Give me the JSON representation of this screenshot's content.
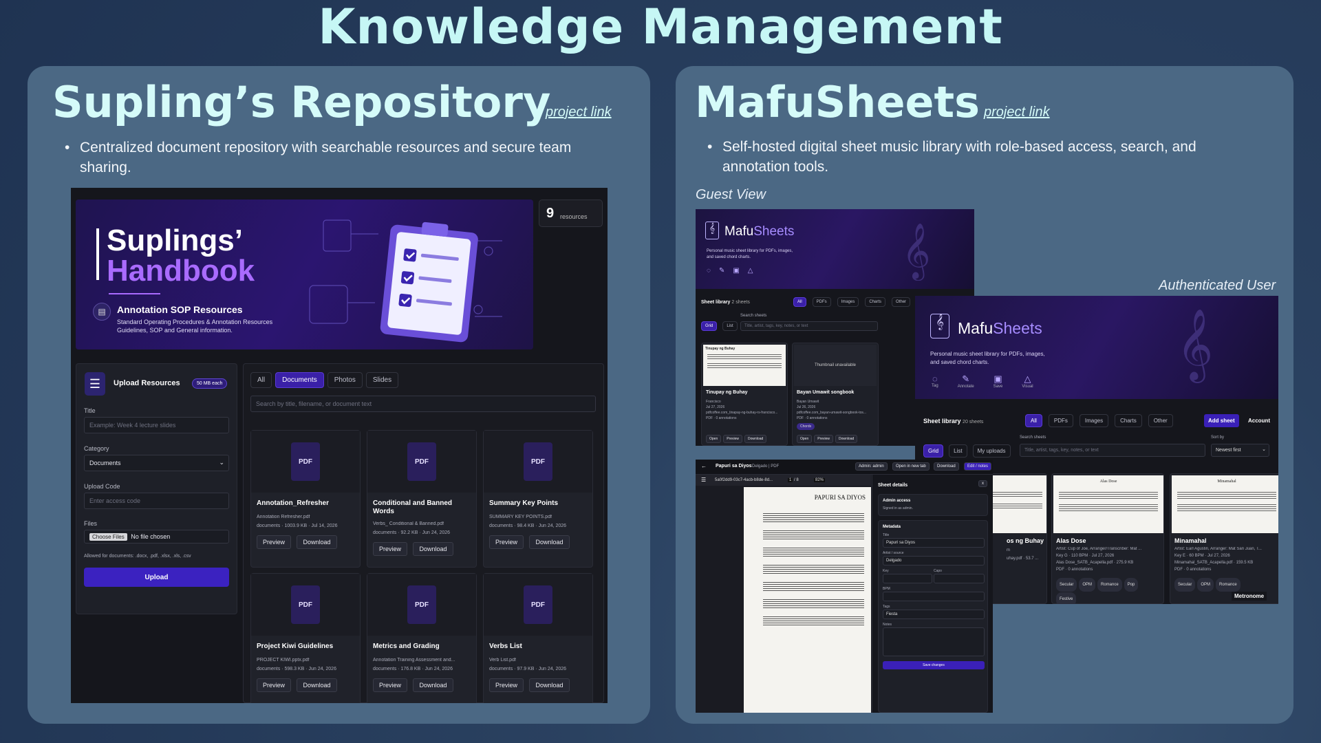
{
  "page": {
    "title": "Knowledge Management"
  },
  "left": {
    "title": "Supling’s Repository",
    "link": "project link",
    "desc": "Centralized document repository with searchable resources and secure team sharing.",
    "app": {
      "resources_count": "9",
      "resources_label": "resources",
      "hero": {
        "line1": "Suplings’",
        "line2": "Handbook",
        "sub": "Annotation SOP Resources",
        "desc1": "Standard Operating Procedures & Annotation Resources",
        "desc2": "Guidelines, SOP and General information."
      },
      "upload": {
        "title": "Upload Resources",
        "limit": "50 MB each",
        "title_label": "Title",
        "title_ph": "Example: Week 4 lecture slides",
        "cat_label": "Category",
        "cat_value": "Documents",
        "code_label": "Upload Code",
        "code_ph": "Enter access code",
        "files_label": "Files",
        "choose": "Choose Files",
        "nofile": "No file chosen",
        "allowed": "Allowed for documents: .docx, .pdf, .xlsx, .xls, .csv",
        "button": "Upload"
      },
      "tabs": [
        "All",
        "Documents",
        "Photos",
        "Slides"
      ],
      "search_ph": "Search by title, filename, or document text",
      "pdf_label": "PDF",
      "preview": "Preview",
      "download": "Download",
      "docs": [
        {
          "title": "Annotation_Refresher",
          "file": "Annotation Refresher.pdf",
          "meta": "documents · 1003.9 KB · Jul 14, 2026"
        },
        {
          "title": "Conditional and Banned Words",
          "file": "Verbs_ Conditional & Banned.pdf",
          "meta": "documents · 92.2 KB · Jun 24, 2026"
        },
        {
          "title": "Summary Key Points",
          "file": "SUMMARY KEY POINTS.pdf",
          "meta": "documents · 98.4 KB · Jun 24, 2026"
        },
        {
          "title": "Project Kiwi Guidelines",
          "file": "PROJECT KIWI.pptx.pdf",
          "meta": "documents · 598.3 KB · Jun 24, 2026"
        },
        {
          "title": "Metrics and Grading",
          "file": "Annotation Training Assessment and...",
          "meta": "documents · 176.8 KB · Jun 24, 2026"
        },
        {
          "title": "Verbs List",
          "file": "Verb List.pdf",
          "meta": "documents · 97.9 KB · Jun 24, 2026"
        }
      ]
    }
  },
  "right": {
    "title": "MafuSheets",
    "link": "project link",
    "desc": "Self-hosted digital sheet music library with role-based access, search, and annotation tools.",
    "guest_caption": "Guest View",
    "auth_caption": "Authenticated User",
    "brand_a": "Mafu",
    "brand_b": "Sheets",
    "tagline1": "Personal music sheet library for PDFs, images,",
    "tagline2": "and saved chord charts.",
    "features": [
      "Tag",
      "Annotate",
      "Save",
      "Visual"
    ],
    "library": "Sheet library",
    "guest_count": "2 sheets",
    "auth_count": "20 sheets",
    "filters": [
      "All",
      "PDFs",
      "Images",
      "Charts",
      "Other"
    ],
    "search_label": "Search sheets",
    "search_ph": "Title, artist, tags, key, notes, or text",
    "views": [
      "Grid",
      "List"
    ],
    "my_uploads": "My uploads",
    "sort_label": "Sort by",
    "sort_value": "Newest first",
    "add_sheet": "Add sheet",
    "account": "Account",
    "guest_sheets": [
      {
        "title": "Tinupay ng Buhay",
        "l1": "Francisco",
        "l2": "Jul 27, 2026",
        "l3": "pdfcoffee.com_tinapay-ng-buhay-rs-francisco...",
        "l4": "PDF · 0 annotations"
      },
      {
        "title": "Bayan Umawit songbook",
        "l1": "Bayan Umawit",
        "l2": "Jul 26, 2026",
        "l3": "pdfcoffee.com_bayan-umawit-songbook-tos...",
        "l4": "PDF · 0 annotations",
        "chip": "Chords",
        "thumb": "Thumbnail unavailable"
      }
    ],
    "open": "Open",
    "preview": "Preview",
    "download": "Download",
    "auth_sheets": [
      {
        "title": "os ng Buhay",
        "l1": "m",
        "l2": "uhay.pdf · 53.7 ..."
      },
      {
        "title": "Alas Dose",
        "l1": "Artist: Cup of Joe, Arranger/Transcriber: Mat ...",
        "l2": "Key G · 110 BPM · Jul 27, 2026",
        "l3": "Alas Dose_SATB_Acapella.pdf · 275.9 KB",
        "l4": "PDF · 0 annotations",
        "chips": [
          "Secular",
          "OPM",
          "Romance",
          "Pop",
          "Festive"
        ],
        "sheet_title": "Alas Dose"
      },
      {
        "title": "Minamahal",
        "l1": "Artist: Earl Agustin, Arranger: Mat San Juan, T...",
        "l2": "Key E · 60 BPM · Jul 27, 2026",
        "l3": "Minamahal_SATB_Acapella.pdf · 159.5 KB",
        "l4": "PDF · 0 annotations",
        "chips": [
          "Secular",
          "OPM",
          "Romance"
        ],
        "sheet_title": "Minamahal"
      }
    ],
    "metronome": "Metronome",
    "editor": {
      "title": "Papuri sa Diyos",
      "sub": "Delgado | PDF",
      "admin": "Admin: admin",
      "open_tab": "Open in new tab",
      "download": "Download",
      "edit": "Edit / notes",
      "file": "5a0f2dd9-03c7-4acb-b8de-8d...",
      "page": "1",
      "pages": "/ 8",
      "zoom": "82%",
      "sheet_heading": "PAPURI SA DIYOS",
      "details": "Sheet details",
      "close": "x",
      "access": "Admin access",
      "signed": "Signed in as admin.",
      "meta": "Metadata",
      "title_lbl": "Title",
      "title_val": "Papuri sa Diyos",
      "artist_lbl": "Artist / source",
      "artist_val": "Delgado",
      "key_lbl": "Key",
      "capo_lbl": "Capo",
      "bpm_lbl": "BPM",
      "tags_lbl": "Tags",
      "tags_val": "Fiesta",
      "notes_lbl": "Notes",
      "save": "Save changes"
    }
  }
}
